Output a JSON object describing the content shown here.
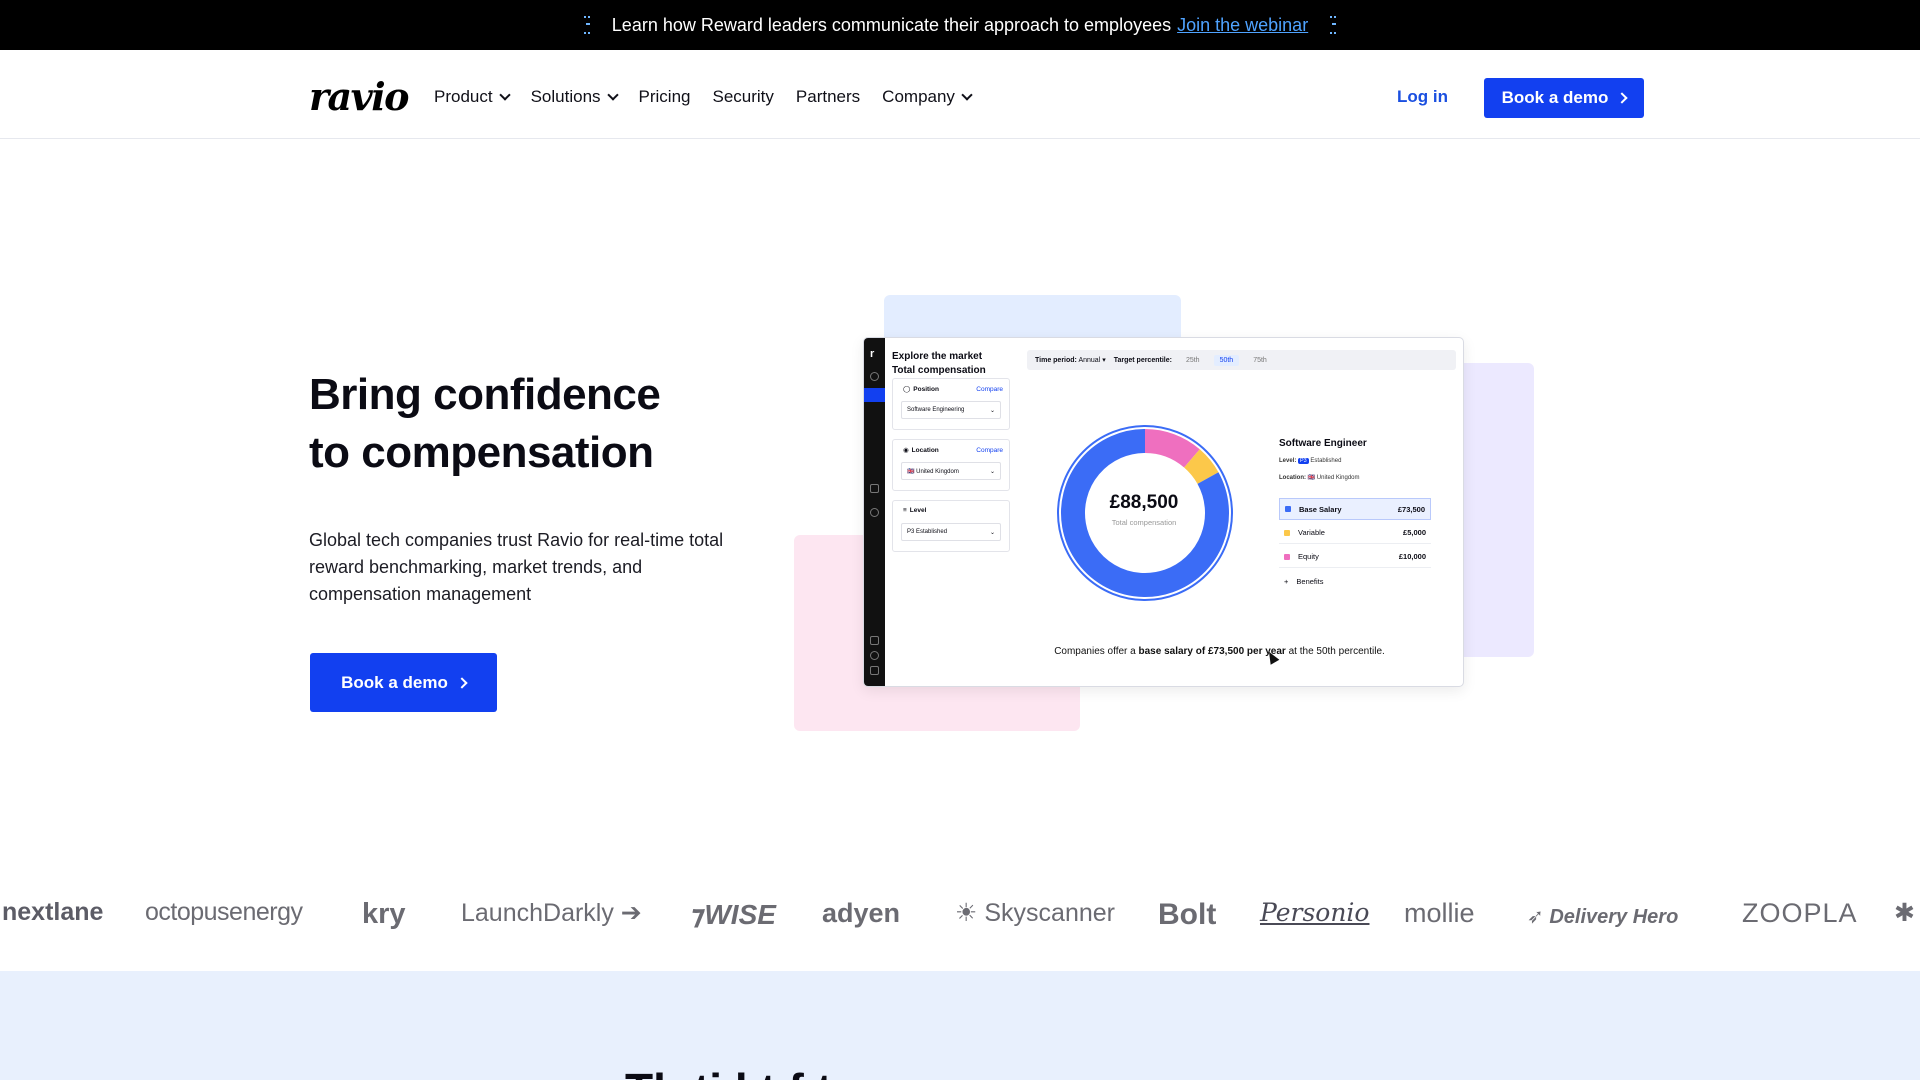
{
  "announcement": {
    "text": "Learn how Reward leaders communicate their approach to employees",
    "link": "Join the webinar"
  },
  "nav": {
    "logo": "ravio",
    "items": [
      "Product",
      "Solutions",
      "Pricing",
      "Security",
      "Partners",
      "Company"
    ],
    "login": "Log in",
    "cta": "Book a demo"
  },
  "hero": {
    "title_line1": "Bring confidence",
    "title_line2": "to compensation",
    "subtitle": "Global tech companies trust Ravio for real-time total reward benchmarking, market trends, and compensation management",
    "cta": "Book a demo"
  },
  "dashboard": {
    "title1": "Explore the market",
    "title2": "Total compensation",
    "time_period_label": "Time period:",
    "time_period_value": "Annual",
    "target_percentile_label": "Target percentile:",
    "percentiles": [
      "25th",
      "50th",
      "75th"
    ],
    "selected_percentile": "50th",
    "filters": [
      {
        "label": "Position",
        "compare": "Compare",
        "value": "Software Engineering"
      },
      {
        "label": "Location",
        "compare": "Compare",
        "value": "🇬🇧 United Kingdom"
      },
      {
        "label": "Level",
        "compare": "",
        "value": "P3 Established"
      }
    ],
    "total": "£88,500",
    "total_label": "Total compensation",
    "role": "Software Engineer",
    "level_label": "Level:",
    "level_badge": "P3",
    "level_value": "Established",
    "location_label": "Location:",
    "location_value": "🇬🇧 United Kingdom",
    "breakdown": [
      {
        "name": "Base Salary",
        "value": "£73,500",
        "color": "#3b6cf6"
      },
      {
        "name": "Variable",
        "value": "£5,000",
        "color": "#fcc84a"
      },
      {
        "name": "Equity",
        "value": "£10,000",
        "color": "#ef6fbf"
      },
      {
        "name": "Benefits",
        "value": "",
        "color": ""
      }
    ],
    "footer_pre": "Companies offer a",
    "footer_bold": "base salary of £73,500 per year",
    "footer_post": "at the 50th percentile."
  },
  "customer_logos": [
    "nextlane",
    "octopusenergy",
    "kry",
    "LaunchDarkly",
    "WISE",
    "adyen",
    "Skyscanner",
    "Bolt",
    "Personio",
    "mollie",
    "Delivery Hero",
    "ZOOPLA"
  ],
  "colors": {
    "primary": "#1240f0",
    "announcement_bg": "#000000",
    "link": "#4fa3ff"
  }
}
